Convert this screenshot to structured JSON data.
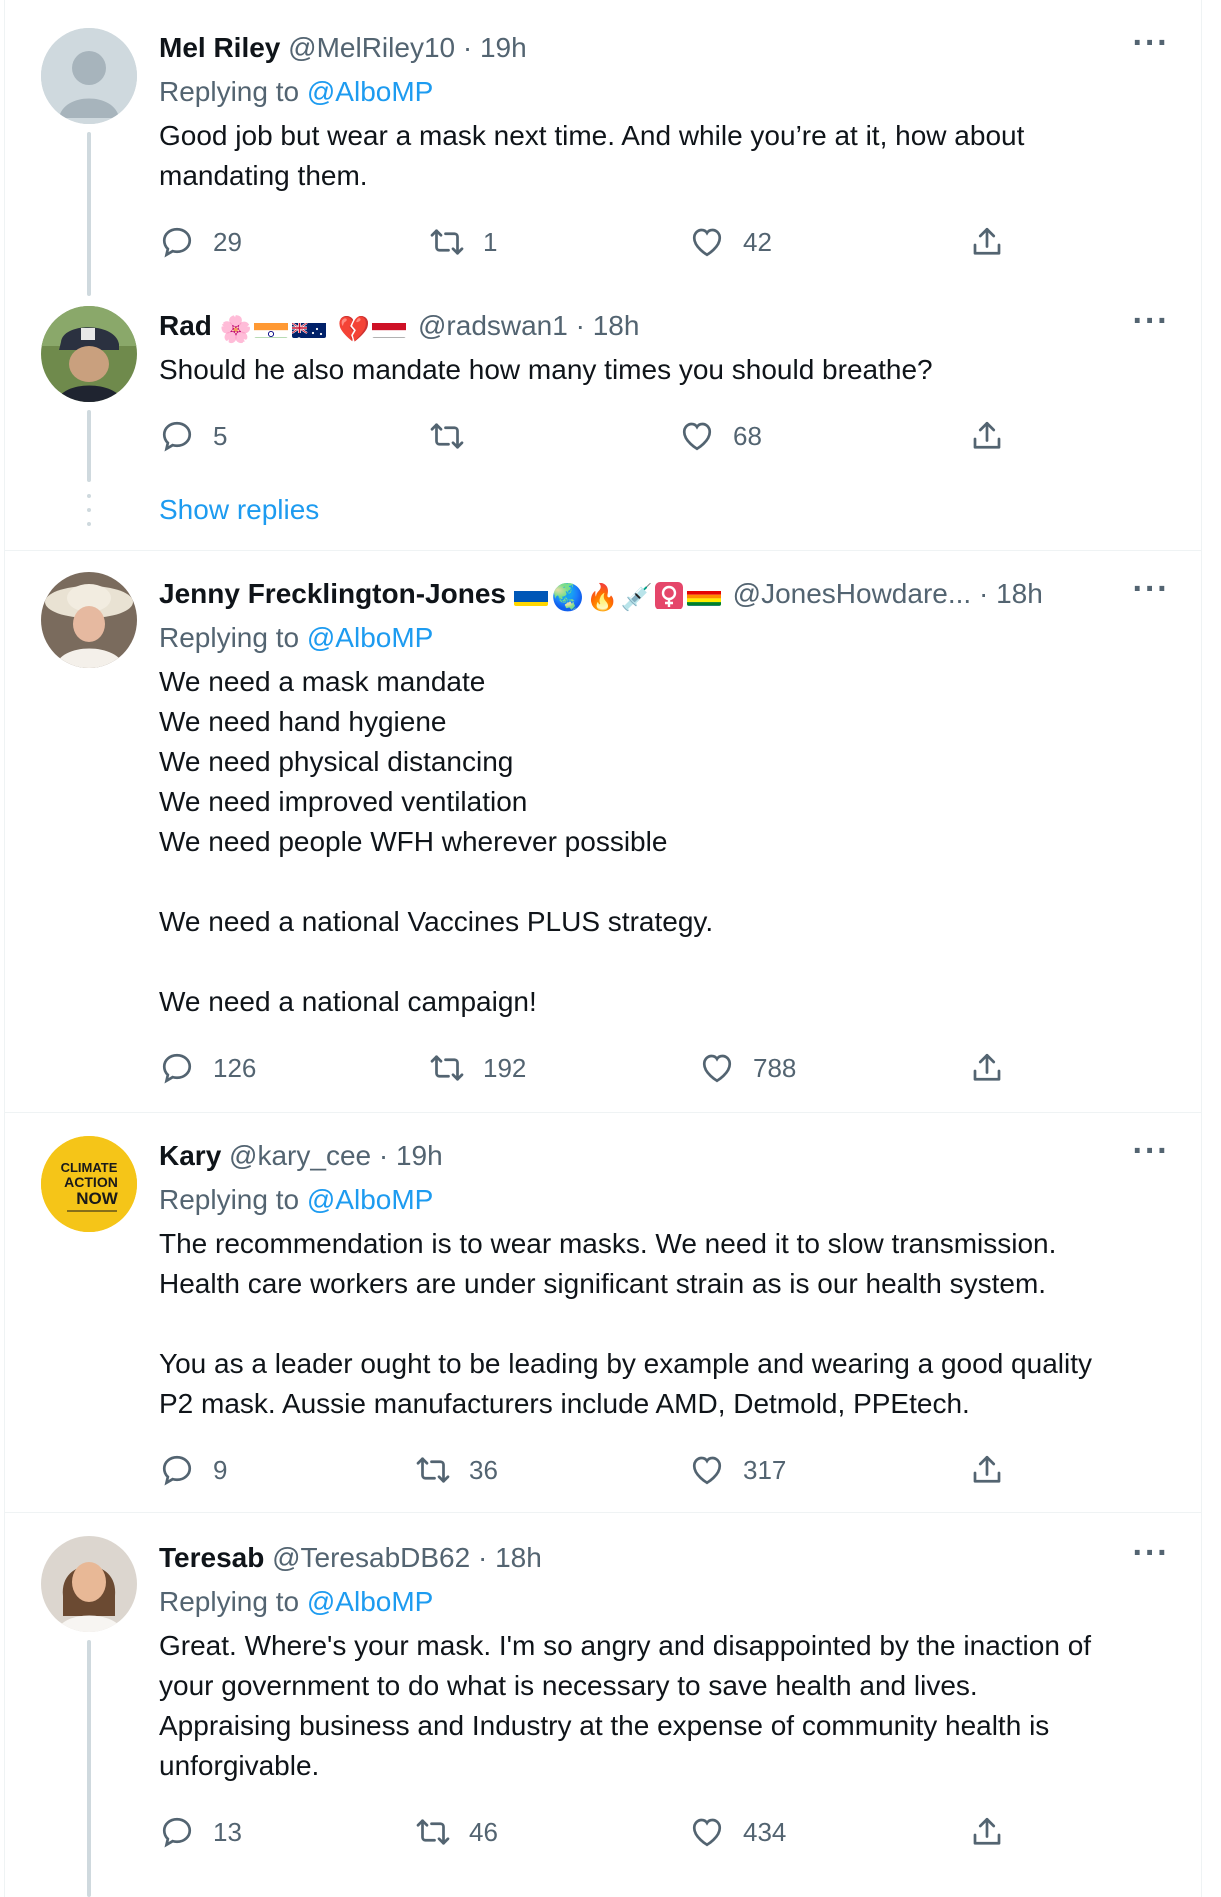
{
  "tweets": [
    {
      "name": "Mel Riley",
      "handle": "@MelRiley10",
      "time": "· 19h",
      "replying_prefix": "Replying to ",
      "replying_to": "@AlboMP",
      "text": "Good job but wear a mask next time. And while you’re at it, how about\nmandating them.",
      "replies": "29",
      "retweets": "1",
      "likes": "42"
    },
    {
      "name": "Rad",
      "badges": [
        "🌸",
        "flag-india",
        "flag-australia",
        "💔",
        "flag-yemen"
      ],
      "handle": "@radswan1",
      "time": "· 18h",
      "text": "Should he also mandate how many times you should breathe?",
      "replies": "5",
      "retweets": "",
      "likes": "68",
      "show_replies": "Show replies"
    },
    {
      "name": "Jenny Frecklington-Jones",
      "badges": [
        "flag-ukraine",
        "🌏",
        "🔥",
        "💉",
        "♀",
        "flag-rainbow"
      ],
      "handle": "@JonesHowdare...",
      "time": "· 18h",
      "replying_prefix": "Replying to ",
      "replying_to": "@AlboMP",
      "text": "We need a mask mandate\nWe need hand hygiene\nWe need physical distancing\nWe need improved ventilation\nWe need people WFH wherever possible\n\nWe need a national Vaccines PLUS strategy.\n\nWe need a national campaign!",
      "replies": "126",
      "retweets": "192",
      "likes": "788"
    },
    {
      "name": "Kary",
      "handle": "@kary_cee",
      "time": "· 19h",
      "replying_prefix": "Replying to ",
      "replying_to": "@AlboMP",
      "avatar_text": [
        "CLIMATE",
        "ACTION",
        "NOW"
      ],
      "text": "The recommendation is to wear masks. We need it to slow transmission.\nHealth care workers are under significant strain as is our health system.\n\nYou as a leader ought to be leading by example and wearing a good quality\nP2 mask. Aussie manufacturers include AMD, Detmold, PPEtech.",
      "replies": "9",
      "retweets": "36",
      "likes": "317"
    },
    {
      "name": "Teresab",
      "handle": "@TeresabDB62",
      "time": "· 18h",
      "replying_prefix": "Replying to ",
      "replying_to": "@AlboMP",
      "text": "Great. Where's your mask. I'm so angry and disappointed by the inaction of\nyour government to do what is necessary to save health and lives.\nAppraising business and Industry at the expense of community health is\nunforgivable.",
      "replies": "13",
      "retweets": "46",
      "likes": "434"
    }
  ],
  "icons": {
    "reply": "reply-icon",
    "retweet": "retweet-icon",
    "like": "heart-icon",
    "share": "share-icon",
    "more": "more-icon"
  },
  "colors": {
    "link": "#1d9bf0",
    "secondary": "#536471",
    "thread": "#cfd9de"
  }
}
